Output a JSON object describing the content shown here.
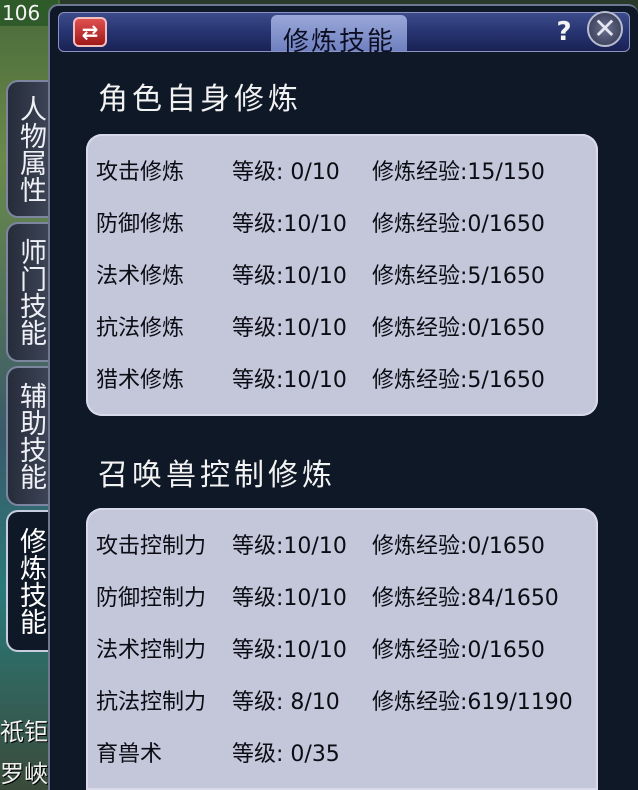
{
  "background": {
    "corner_number": "106",
    "bottom_text_1": "祇钜",
    "bottom_text_2": "罗峽"
  },
  "window": {
    "title": "修炼技能",
    "swap_icon": "swap-arrows-icon",
    "help_label": "?",
    "close_label": "✕"
  },
  "side_tabs": [
    {
      "label": "人物属性",
      "active": false
    },
    {
      "label": "师门技能",
      "active": false
    },
    {
      "label": "辅助技能",
      "active": false
    },
    {
      "label": "修炼技能",
      "active": true
    }
  ],
  "self_training": {
    "heading": "角色自身修炼",
    "rows": [
      {
        "name": "攻击修炼",
        "level": "等级: 0/10",
        "exp": "修炼经验:15/150"
      },
      {
        "name": "防御修炼",
        "level": "等级:10/10",
        "exp": "修炼经验:0/1650"
      },
      {
        "name": "法术修炼",
        "level": "等级:10/10",
        "exp": "修炼经验:5/1650"
      },
      {
        "name": "抗法修炼",
        "level": "等级:10/10",
        "exp": "修炼经验:0/1650"
      },
      {
        "name": "猎术修炼",
        "level": "等级:10/10",
        "exp": "修炼经验:5/1650"
      }
    ]
  },
  "pet_training": {
    "heading": "召唤兽控制修炼",
    "rows": [
      {
        "name": "攻击控制力",
        "level": "等级:10/10",
        "exp": "修炼经验:0/1650"
      },
      {
        "name": "防御控制力",
        "level": "等级:10/10",
        "exp": "修炼经验:84/1650"
      },
      {
        "name": "法术控制力",
        "level": "等级:10/10",
        "exp": "修炼经验:0/1650"
      },
      {
        "name": "抗法控制力",
        "level": "等级: 8/10",
        "exp": "修炼经验:619/1190"
      },
      {
        "name": "育兽术",
        "level": "等级: 0/35",
        "exp": ""
      }
    ]
  }
}
